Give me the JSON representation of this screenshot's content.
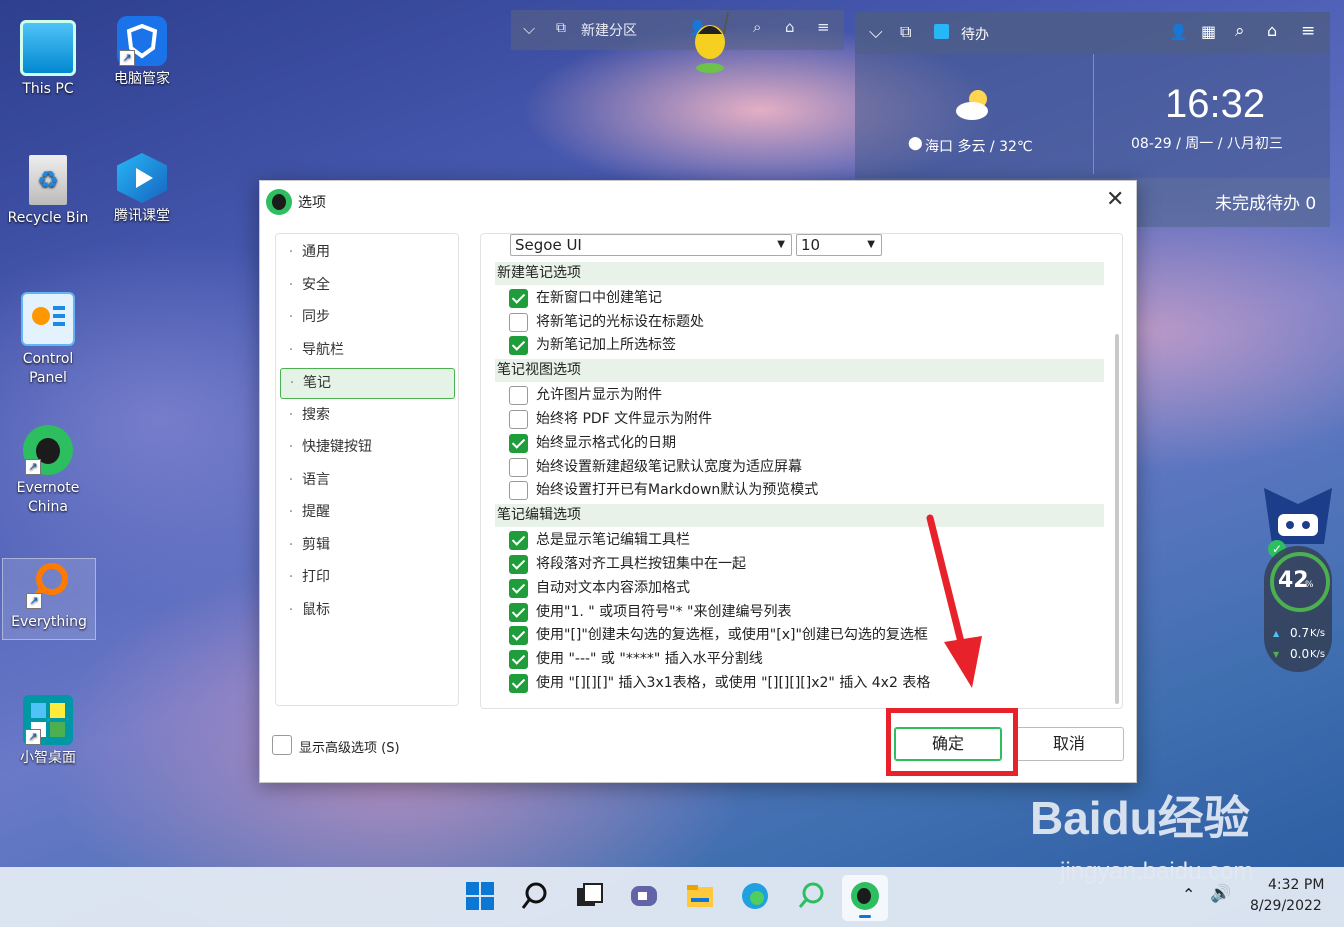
{
  "desktop": {
    "icons": [
      {
        "label": "This PC"
      },
      {
        "label": "电脑管家"
      },
      {
        "label": "Recycle Bin"
      },
      {
        "label": "腾讯课堂"
      },
      {
        "label": "Control Panel"
      },
      {
        "label": "Evernote China"
      },
      {
        "label": "Everything"
      },
      {
        "label": "小智桌面"
      }
    ]
  },
  "partition_widget": {
    "title": "新建分区"
  },
  "todo_widget": {
    "title": "待办",
    "weather": "海口 多云 / 32℃",
    "time": "16:32",
    "date": "08-29 / 周一 / 八月初三",
    "pending": "未完成待办 0"
  },
  "speed_widget": {
    "percent": "42",
    "percent_unit": "%",
    "upload": "0.7",
    "download": "0.0",
    "rate_unit": "K/s"
  },
  "dialog": {
    "title": "选项",
    "nav": [
      "通用",
      "安全",
      "同步",
      "导航栏",
      "笔记",
      "搜索",
      "快捷键按钮",
      "语言",
      "提醒",
      "剪辑",
      "打印",
      "鼠标"
    ],
    "active_nav": "笔记",
    "font_name": "Segoe UI",
    "font_size": "10",
    "sections": [
      {
        "title": "新建笔记选项"
      },
      {
        "title": "笔记视图选项"
      },
      {
        "title": "笔记编辑选项"
      }
    ],
    "options": [
      {
        "label": "在新窗口中创建笔记",
        "checked": true
      },
      {
        "label": "将新笔记的光标设在标题处",
        "checked": false
      },
      {
        "label": "为新笔记加上所选标签",
        "checked": true
      },
      {
        "label": "允许图片显示为附件",
        "checked": false
      },
      {
        "label": "始终将 PDF 文件显示为附件",
        "checked": false
      },
      {
        "label": "始终显示格式化的日期",
        "checked": true
      },
      {
        "label": "始终设置新建超级笔记默认宽度为适应屏幕",
        "checked": false
      },
      {
        "label": "始终设置打开已有Markdown默认为预览模式",
        "checked": false
      },
      {
        "label": "总是显示笔记编辑工具栏",
        "checked": true
      },
      {
        "label": "将段落对齐工具栏按钮集中在一起",
        "checked": true
      },
      {
        "label": "自动对文本内容添加格式",
        "checked": true
      },
      {
        "label": "使用\"1. \" 或项目符号\"* \"来创建编号列表",
        "checked": true
      },
      {
        "label": "使用\"[]\"创建未勾选的复选框，或使用\"[x]\"创建已勾选的复选框",
        "checked": true
      },
      {
        "label": "使用 \"---\" 或 \"****\" 插入水平分割线",
        "checked": true
      },
      {
        "label": "使用 \"[][][]\" 插入3x1表格，或使用 \"[][][][]x2\" 插入 4x2 表格",
        "checked": true
      }
    ],
    "advanced_label": "显示高级选项 (S)",
    "ok_label": "确定",
    "cancel_label": "取消"
  },
  "watermark": {
    "brand": "Baidu经验",
    "url": "jingyan.baidu.com"
  },
  "taskbar": {
    "time": "4:32 PM",
    "date": "8/29/2022"
  },
  "colors": {
    "accent_green": "#1f9d3a",
    "annotation_red": "#e8222a"
  }
}
